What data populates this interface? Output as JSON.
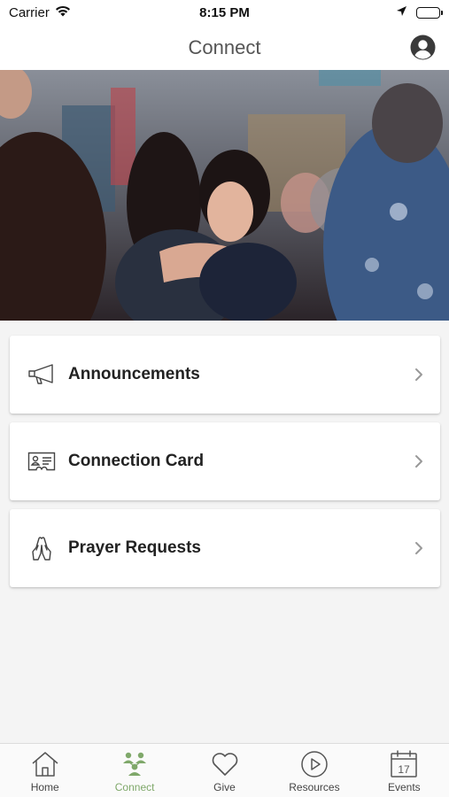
{
  "status_bar": {
    "carrier": "Carrier",
    "time": "8:15 PM"
  },
  "nav": {
    "title": "Connect"
  },
  "menu": [
    {
      "label": "Announcements",
      "icon": "megaphone-icon"
    },
    {
      "label": "Connection Card",
      "icon": "id-card-icon"
    },
    {
      "label": "Prayer Requests",
      "icon": "praying-hands-icon"
    }
  ],
  "tabs": [
    {
      "label": "Home",
      "icon": "home-icon",
      "active": false
    },
    {
      "label": "Connect",
      "icon": "people-icon",
      "active": true
    },
    {
      "label": "Give",
      "icon": "heart-icon",
      "active": false
    },
    {
      "label": "Resources",
      "icon": "play-icon",
      "active": false
    },
    {
      "label": "Events",
      "icon": "calendar-icon",
      "active": false
    }
  ],
  "calendar_day": "17",
  "colors": {
    "accent": "#7fa86a",
    "background": "#f4f4f4",
    "card": "#ffffff",
    "text": "#222222",
    "nav_title": "#555555"
  }
}
